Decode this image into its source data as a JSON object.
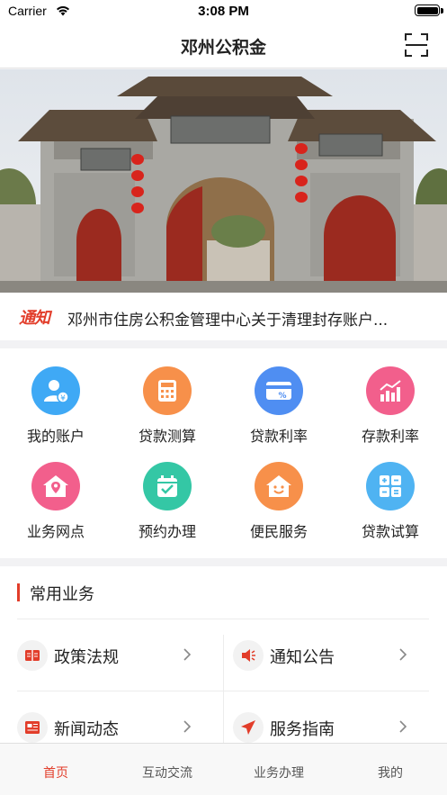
{
  "status_bar": {
    "carrier": "Carrier",
    "time": "3:08 PM"
  },
  "nav": {
    "title": "邓州公积金",
    "scan_icon": "scan-icon"
  },
  "notice": {
    "tag": "通知",
    "text": "邓州市住房公积金管理中心关于清理封存账户..."
  },
  "grid": [
    {
      "label": "我的账户",
      "icon": "account-icon",
      "color": "#3fa9f5"
    },
    {
      "label": "贷款测算",
      "icon": "calculator-icon",
      "color": "#f7904a"
    },
    {
      "label": "贷款利率",
      "icon": "rate-card-icon",
      "color": "#4f8ef2"
    },
    {
      "label": "存款利率",
      "icon": "bar-chart-icon",
      "color": "#f25f8c"
    },
    {
      "label": "业务网点",
      "icon": "location-house-icon",
      "color": "#f25f8c"
    },
    {
      "label": "预约办理",
      "icon": "calendar-check-icon",
      "color": "#34c7a5"
    },
    {
      "label": "便民服务",
      "icon": "smile-house-icon",
      "color": "#f7904a"
    },
    {
      "label": "贷款试算",
      "icon": "calc-grid-icon",
      "color": "#4fb3f2"
    }
  ],
  "business": {
    "title": "常用业务",
    "items": [
      {
        "label": "政策法规",
        "icon": "book-icon"
      },
      {
        "label": "通知公告",
        "icon": "megaphone-icon"
      },
      {
        "label": "新闻动态",
        "icon": "newspaper-icon"
      },
      {
        "label": "服务指南",
        "icon": "send-icon"
      }
    ]
  },
  "tabs": [
    {
      "label": "首页",
      "active": true
    },
    {
      "label": "互动交流",
      "active": false
    },
    {
      "label": "业务办理",
      "active": false
    },
    {
      "label": "我的",
      "active": false
    }
  ],
  "colors": {
    "accent": "#e23d2a"
  }
}
